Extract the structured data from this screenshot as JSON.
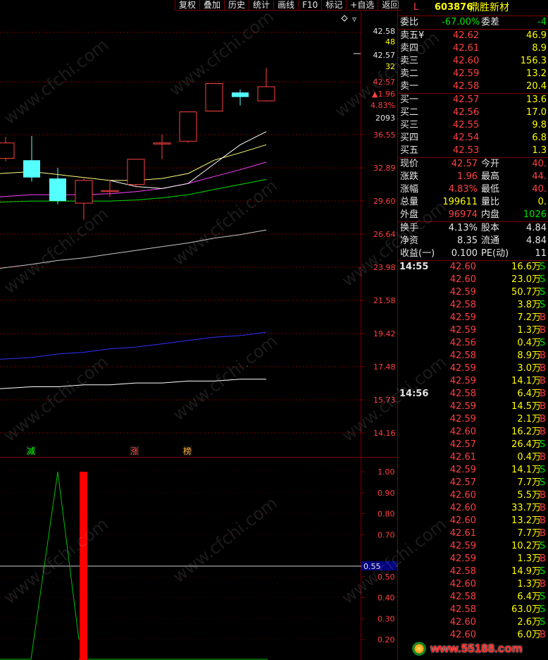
{
  "toolbar": [
    "复权",
    "叠加",
    "历史",
    "统计",
    "画线",
    "F10",
    "标记",
    "+自选",
    "返回"
  ],
  "indicator_icon": "diamond-icon",
  "price_axis": {
    "ticks": [
      "36.55",
      "32.89",
      "29.60",
      "26.64",
      "23.98",
      "21.58",
      "19.42",
      "17.48",
      "15.73",
      "14.16"
    ],
    "info": {
      "p1": "42.58",
      "v1": "48",
      "p2": "42.57",
      "v2": "32",
      "p3": "42.57",
      "chg": "▲1.96",
      "pct": "4.83%",
      "vol": "2093"
    }
  },
  "event_marks": [
    "减",
    "涨",
    "榜"
  ],
  "sub_axis": {
    "ticks": [
      "1.00",
      "0.90",
      "0.80",
      "0.70",
      "0.50",
      "0.40",
      "0.30",
      "0.20"
    ],
    "cursor_value": "0.55"
  },
  "watermark": "www.cfchi.com",
  "site_mark": "www.55188.com",
  "colors": {
    "up": "#ff4040",
    "down": "#54ffff",
    "ma5": "#ffffff",
    "ma10": "#ffff80",
    "ma20": "#ff40ff",
    "ma30": "#00e000",
    "ma60": "#c8c8c8",
    "ma120": "#3030ff",
    "ma250": "#ffffff",
    "grid": "#7a0000",
    "sub_bar": "#ff0000",
    "sub_line": "#00c000"
  },
  "quote": {
    "level": "L",
    "code": "603876",
    "name": "鼎胜新材",
    "webi_label": "委比",
    "webi_value": "-67.00%",
    "weicha_label": "委差",
    "weicha_value": "-4",
    "asks": [
      {
        "label": "卖五",
        "mark": "¥",
        "price": "42.62",
        "vol": "46.9"
      },
      {
        "label": "卖四",
        "mark": "",
        "price": "42.61",
        "vol": "8.9"
      },
      {
        "label": "卖三",
        "mark": "",
        "price": "42.60",
        "vol": "156.3"
      },
      {
        "label": "卖二",
        "mark": "",
        "price": "42.59",
        "vol": "13.2"
      },
      {
        "label": "卖一",
        "mark": "",
        "price": "42.58",
        "vol": "20.4"
      }
    ],
    "bids": [
      {
        "label": "买一",
        "price": "42.57",
        "vol": "13.6"
      },
      {
        "label": "买二",
        "price": "42.56",
        "vol": "17.0"
      },
      {
        "label": "买三",
        "price": "42.55",
        "vol": "9.8"
      },
      {
        "label": "买四",
        "price": "42.54",
        "vol": "6.8"
      },
      {
        "label": "买五",
        "price": "42.53",
        "vol": "1.3"
      }
    ],
    "stats1": [
      {
        "l": "现价",
        "v": "42.57",
        "vc": "red",
        "l2": "今开",
        "v2": "40.",
        "v2c": "red"
      },
      {
        "l": "涨跌",
        "v": "1.96",
        "vc": "red",
        "l2": "最高",
        "v2": "44.",
        "v2c": "red"
      },
      {
        "l": "涨幅",
        "v": "4.83%",
        "vc": "red",
        "l2": "最低",
        "v2": "40.",
        "v2c": "red"
      },
      {
        "l": "总量",
        "v": "199611",
        "vc": "yel",
        "l2": "量比",
        "v2": "0.",
        "v2c": "yel"
      },
      {
        "l": "外盘",
        "v": "96974",
        "vc": "red",
        "l2": "内盘",
        "v2": "1026",
        "v2c": "grn"
      }
    ],
    "stats2": [
      {
        "l": "换手",
        "v": "4.13%",
        "l2": "股本",
        "v2": "4.84"
      },
      {
        "l": "净资",
        "v": "8.35",
        "l2": "流通",
        "v2": "4.84"
      },
      {
        "l": "收益(一)",
        "v": "0.100",
        "l2": "PE(动)",
        "v2": "11"
      }
    ],
    "ticks": [
      {
        "t": "14:55",
        "p": "42.60",
        "v": "16.6万",
        "s": "S"
      },
      {
        "t": "",
        "p": "42.60",
        "v": "23.0万",
        "s": "S"
      },
      {
        "t": "",
        "p": "42.59",
        "v": "50.7万",
        "s": "S"
      },
      {
        "t": "",
        "p": "42.58",
        "v": "3.8万",
        "s": "S"
      },
      {
        "t": "",
        "p": "42.59",
        "v": "7.2万",
        "s": "B"
      },
      {
        "t": "",
        "p": "42.59",
        "v": "1.3万",
        "s": "B"
      },
      {
        "t": "",
        "p": "42.56",
        "v": "0.4万",
        "s": "S"
      },
      {
        "t": "",
        "p": "42.58",
        "v": "8.9万",
        "s": "B"
      },
      {
        "t": "",
        "p": "42.59",
        "v": "3.0万",
        "s": "B"
      },
      {
        "t": "",
        "p": "42.59",
        "v": "14.1万",
        "s": "B"
      },
      {
        "t": "14:56",
        "p": "42.58",
        "v": "6.4万",
        "s": "B"
      },
      {
        "t": "",
        "p": "42.59",
        "v": "14.5万",
        "s": "B"
      },
      {
        "t": "",
        "p": "42.59",
        "v": "2.1万",
        "s": "B"
      },
      {
        "t": "",
        "p": "42.60",
        "v": "16.2万",
        "s": "B"
      },
      {
        "t": "",
        "p": "42.57",
        "v": "26.4万",
        "s": "S"
      },
      {
        "t": "",
        "p": "42.61",
        "v": "0.4万",
        "s": "B"
      },
      {
        "t": "",
        "p": "42.59",
        "v": "14.1万",
        "s": "S"
      },
      {
        "t": "",
        "p": "42.57",
        "v": "7.7万",
        "s": "S"
      },
      {
        "t": "",
        "p": "42.60",
        "v": "5.5万",
        "s": "B"
      },
      {
        "t": "",
        "p": "42.60",
        "v": "33.7万",
        "s": "B"
      },
      {
        "t": "",
        "p": "42.60",
        "v": "13.2万",
        "s": "B"
      },
      {
        "t": "",
        "p": "42.61",
        "v": "7.7万",
        "s": "B"
      },
      {
        "t": "",
        "p": "42.59",
        "v": "10.2万",
        "s": "S"
      },
      {
        "t": "",
        "p": "42.59",
        "v": "1.3万",
        "s": "B"
      },
      {
        "t": "",
        "p": "42.58",
        "v": "14.9万",
        "s": "S"
      },
      {
        "t": "",
        "p": "42.60",
        "v": "1.3万",
        "s": "B"
      },
      {
        "t": "",
        "p": "42.58",
        "v": "6.4万",
        "s": "S"
      },
      {
        "t": "",
        "p": "42.58",
        "v": "63.0万",
        "s": "S"
      },
      {
        "t": "",
        "p": "42.60",
        "v": "2.6万",
        "s": "S"
      },
      {
        "t": "",
        "p": "42.60",
        "v": "6.0万",
        "s": "B"
      }
    ]
  },
  "chart_data": {
    "type": "candlestick",
    "candles": [
      {
        "o": 33.9,
        "c": 35.6,
        "h": 36.3,
        "l": 33.6
      },
      {
        "o": 33.7,
        "c": 31.9,
        "h": 36.4,
        "l": 31.5
      },
      {
        "o": 31.8,
        "c": 29.6,
        "h": 32.9,
        "l": 29.3
      },
      {
        "o": 29.4,
        "c": 31.6,
        "h": 31.8,
        "l": 27.9
      },
      {
        "o": 30.6,
        "c": 30.6,
        "h": 31.6,
        "l": 30.0
      },
      {
        "o": 31.2,
        "c": 33.8,
        "h": 33.8,
        "l": 30.9
      },
      {
        "o": 35.6,
        "c": 35.6,
        "h": 36.6,
        "l": 33.8
      },
      {
        "o": 35.8,
        "c": 39.3,
        "h": 39.3,
        "l": 35.6
      },
      {
        "o": 39.4,
        "c": 43.0,
        "h": 43.0,
        "l": 39.4
      },
      {
        "o": 41.8,
        "c": 41.2,
        "h": 42.2,
        "l": 40.1
      },
      {
        "o": 40.7,
        "c": 42.57,
        "h": 45.2,
        "l": 40.6
      }
    ],
    "ma5": [
      null,
      null,
      null,
      null,
      31.6,
      31.0,
      30.8,
      31.3,
      33.3,
      35.4,
      36.9
    ],
    "ma10": [
      32.3,
      32.5,
      32.2,
      31.9,
      31.6,
      31.6,
      31.8,
      32.3,
      33.7,
      34.5,
      35.4
    ],
    "ma20": [
      30.0,
      30.2,
      30.2,
      30.2,
      30.3,
      30.5,
      30.8,
      31.3,
      32.0,
      32.7,
      33.5
    ],
    "ma30": [
      29.5,
      29.6,
      29.6,
      29.6,
      29.6,
      29.7,
      29.9,
      30.2,
      30.7,
      31.2,
      31.7
    ],
    "ma60": [
      23.9,
      24.2,
      24.5,
      24.7,
      25.0,
      25.3,
      25.6,
      25.9,
      26.3,
      26.6,
      27.0
    ],
    "ma120": [
      17.9,
      18.0,
      18.2,
      18.3,
      18.5,
      18.6,
      18.8,
      19.0,
      19.2,
      19.3,
      19.5
    ],
    "ma250": [
      16.3,
      16.4,
      16.4,
      16.5,
      16.5,
      16.6,
      16.6,
      16.7,
      16.7,
      16.8,
      16.8
    ],
    "indicator": [
      0,
      0,
      1.0,
      0.2,
      0,
      0,
      0,
      0,
      0,
      0,
      0
    ],
    "indicator_bar": {
      "index": 3,
      "value": 1.0
    }
  }
}
